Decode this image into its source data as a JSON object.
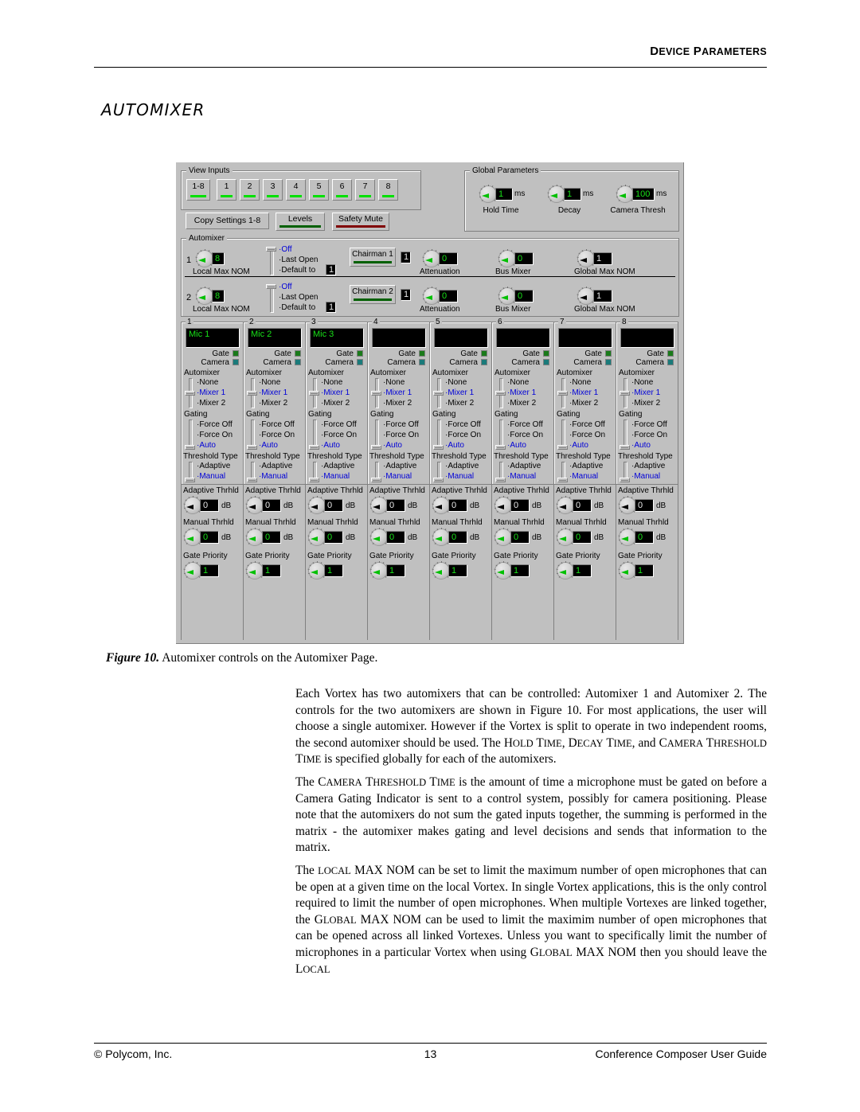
{
  "header": {
    "title_first": "D",
    "title_rest": "EVICE ",
    "title2_first": "P",
    "title2_rest": "ARAMETERS",
    "title_full": "DEVICE PARAMETERS"
  },
  "section": {
    "title": "AUTOMIXER"
  },
  "figure": {
    "label": "Figure 10.",
    "caption": "Automixer controls on the Automixer Page."
  },
  "footer": {
    "left": "© Polycom, Inc.",
    "center": "13",
    "right": "Conference Composer User Guide"
  },
  "body": {
    "p1": "Each Vortex has two automixers that can be controlled: Automixer 1 and Automixer 2.  The controls for the two automixers are shown in Figure 10.  For most applications, the user will choose a single automixer.  However if the Vortex is split to operate in two independent rooms, the second automixer should be used.  The HOLD TIME, DECAY TIME, and CAMERA THRESHOLD TIME is specified globally for each of the automixers.",
    "p2": "The CAMERA THRESHOLD TIME is the amount of time a microphone must be gated on before a Camera Gating Indicator is sent to a control system, possibly for camera positioning.  Please note that the automixers do not sum the gated inputs together, the summing is performed in the matrix - the automixer makes gating and level decisions and sends that information to the matrix.",
    "p3": "The LOCAL MAX NOM can be set to limit the maximum number of open microphones that can be open at a given time on the local Vortex. In single Vortex applications, this is the only control required to limit the number of open microphones. When multiple Vortexes are linked together, the GLOBAL MAX NOM can be used to limit the maximim number of open microphones that can be opened across all linked Vortexes.  Unless you want to specifically limit the number of microphones in a particular Vortex when using GLOBAL MAX NOM then you should leave the LOCAL"
  },
  "colors": {
    "face": "#c0c0c0",
    "lcd_bg": "#000000",
    "lcd_green": "#18e018",
    "led_green_bright": "#00e000",
    "led_green_dark": "#006000",
    "led_red_dark": "#800000",
    "gate_led": "#1a7a1a",
    "camera_led": "#1a7a7a",
    "selected_blue": "#0000d8",
    "pointer_green": "#00c000",
    "pointer_black": "#000000"
  },
  "app": {
    "view_inputs": {
      "legend": "View Inputs",
      "buttons": [
        {
          "label": "1-8",
          "led": "green-bright"
        },
        {
          "label": "1",
          "led": "green-bright"
        },
        {
          "label": "2",
          "led": "green-bright"
        },
        {
          "label": "3",
          "led": "green-bright"
        },
        {
          "label": "4",
          "led": "green-bright"
        },
        {
          "label": "5",
          "led": "green-bright"
        },
        {
          "label": "6",
          "led": "green-bright"
        },
        {
          "label": "7",
          "led": "green-bright"
        },
        {
          "label": "8",
          "led": "green-bright"
        }
      ],
      "copy_settings": "Copy Settings 1-8",
      "levels": "Levels",
      "safety_mute": "Safety Mute"
    },
    "global_parameters": {
      "legend": "Global Parameters",
      "knobs": [
        {
          "label": "Hold Time",
          "value": "1",
          "unit": "ms",
          "angle": -45
        },
        {
          "label": "Decay",
          "value": "1",
          "unit": "ms",
          "angle": -45
        },
        {
          "label": "Camera Thresh",
          "value": "100",
          "unit": "ms",
          "angle": -45
        }
      ]
    },
    "automixer": {
      "legend": "Automixer",
      "rows": [
        {
          "index": "1",
          "local_max_nom": {
            "label": "Local Max NOM",
            "value": "8"
          },
          "mode": {
            "options": [
              "Off",
              "Last Open",
              "Default to"
            ],
            "selected": "Off",
            "default_to_value": "1"
          },
          "chairman": {
            "label": "Chairman 1",
            "value": "1"
          },
          "attenuation": {
            "label": "Attenuation",
            "value": "0"
          },
          "bus_mixer": {
            "label": "Bus Mixer",
            "value": "0"
          },
          "global_max_nom": {
            "label": "Global Max NOM",
            "value": "1",
            "disabled": true
          }
        },
        {
          "index": "2",
          "local_max_nom": {
            "label": "Local Max NOM",
            "value": "8"
          },
          "mode": {
            "options": [
              "Off",
              "Last Open",
              "Default to"
            ],
            "selected": "Off",
            "default_to_value": "1"
          },
          "chairman": {
            "label": "Chairman 2",
            "value": "1"
          },
          "attenuation": {
            "label": "Attenuation",
            "value": "0"
          },
          "bus_mixer": {
            "label": "Bus Mixer",
            "value": "0"
          },
          "global_max_nom": {
            "label": "Global Max NOM",
            "value": "1",
            "disabled": true
          }
        }
      ]
    },
    "labels": {
      "gate": "Gate",
      "camera": "Camera",
      "automixer": "Automixer",
      "gating": "Gating",
      "threshold_type": "Threshold Type",
      "adaptive_thrhld": "Adaptive Thrhld",
      "manual_thrhld": "Manual Thrhld",
      "gate_priority": "Gate Priority",
      "db": "dB"
    },
    "options": {
      "automixer": [
        "None",
        "Mixer 1",
        "Mixer 2"
      ],
      "gating": [
        "Force Off",
        "Force On",
        "Auto"
      ],
      "threshold_type": [
        "Adaptive",
        "Manual"
      ]
    },
    "channels": [
      {
        "num": "1",
        "name": "Mic 1",
        "automixer": "Mixer 1",
        "gating": "Auto",
        "threshold_type": "Manual",
        "adaptive": "0",
        "manual": "0",
        "priority": "1"
      },
      {
        "num": "2",
        "name": "Mic 2",
        "automixer": "Mixer 1",
        "gating": "Auto",
        "threshold_type": "Manual",
        "adaptive": "0",
        "manual": "0",
        "priority": "1"
      },
      {
        "num": "3",
        "name": "Mic 3",
        "automixer": "Mixer 1",
        "gating": "Auto",
        "threshold_type": "Manual",
        "adaptive": "0",
        "manual": "0",
        "priority": "1"
      },
      {
        "num": "4",
        "name": "",
        "automixer": "Mixer 1",
        "gating": "Auto",
        "threshold_type": "Manual",
        "adaptive": "0",
        "manual": "0",
        "priority": "1"
      },
      {
        "num": "5",
        "name": "",
        "automixer": "Mixer 1",
        "gating": "Auto",
        "threshold_type": "Manual",
        "adaptive": "0",
        "manual": "0",
        "priority": "1"
      },
      {
        "num": "6",
        "name": "",
        "automixer": "Mixer 1",
        "gating": "Auto",
        "threshold_type": "Manual",
        "adaptive": "0",
        "manual": "0",
        "priority": "1"
      },
      {
        "num": "7",
        "name": "",
        "automixer": "Mixer 1",
        "gating": "Auto",
        "threshold_type": "Manual",
        "adaptive": "0",
        "manual": "0",
        "priority": "1"
      },
      {
        "num": "8",
        "name": "",
        "automixer": "Mixer 1",
        "gating": "Auto",
        "threshold_type": "Manual",
        "adaptive": "0",
        "manual": "0",
        "priority": "1"
      }
    ]
  }
}
